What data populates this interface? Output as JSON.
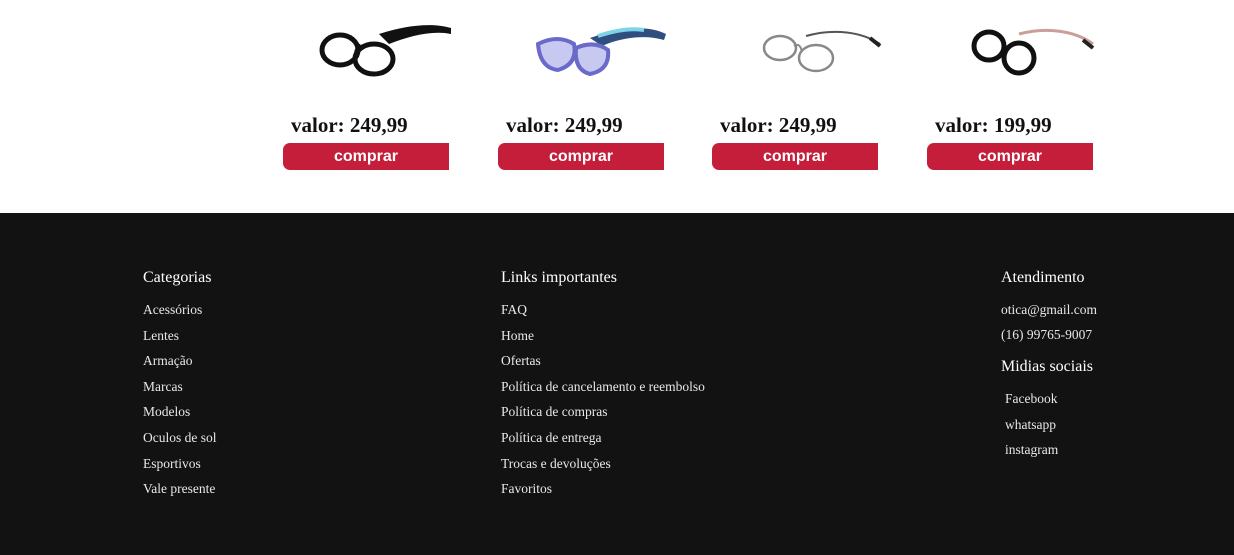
{
  "products": [
    {
      "image": "black-round-glasses",
      "price_label": "valor: 249,99",
      "buy_label": "comprar"
    },
    {
      "image": "blue-kids-glasses",
      "price_label": "valor: 249,99",
      "buy_label": "comprar"
    },
    {
      "image": "silver-wire-glasses",
      "price_label": "valor: 249,99",
      "buy_label": "comprar"
    },
    {
      "image": "black-rosegold-glasses",
      "price_label": "valor: 199,99",
      "buy_label": "comprar"
    }
  ],
  "footer": {
    "categorias": {
      "title": "Categorias",
      "items": [
        "Acessórios",
        "Lentes",
        "Armação",
        "Marcas",
        "Modelos",
        "Oculos de sol",
        "Esportivos",
        "Vale presente"
      ]
    },
    "links": {
      "title": "Links importantes",
      "items": [
        "FAQ",
        "Home",
        "Ofertas",
        "Política de cancelamento e reembolso",
        "Política de compras",
        "Política de entrega",
        "Trocas e devoluções",
        "Favoritos"
      ]
    },
    "atendimento": {
      "title": "Atendimento",
      "email": "otica@gmail.com",
      "phone": "(16) 99765-9007"
    },
    "midias": {
      "title": "Midias sociais",
      "items": [
        "Facebook",
        "whatsapp",
        "instagram"
      ]
    }
  }
}
